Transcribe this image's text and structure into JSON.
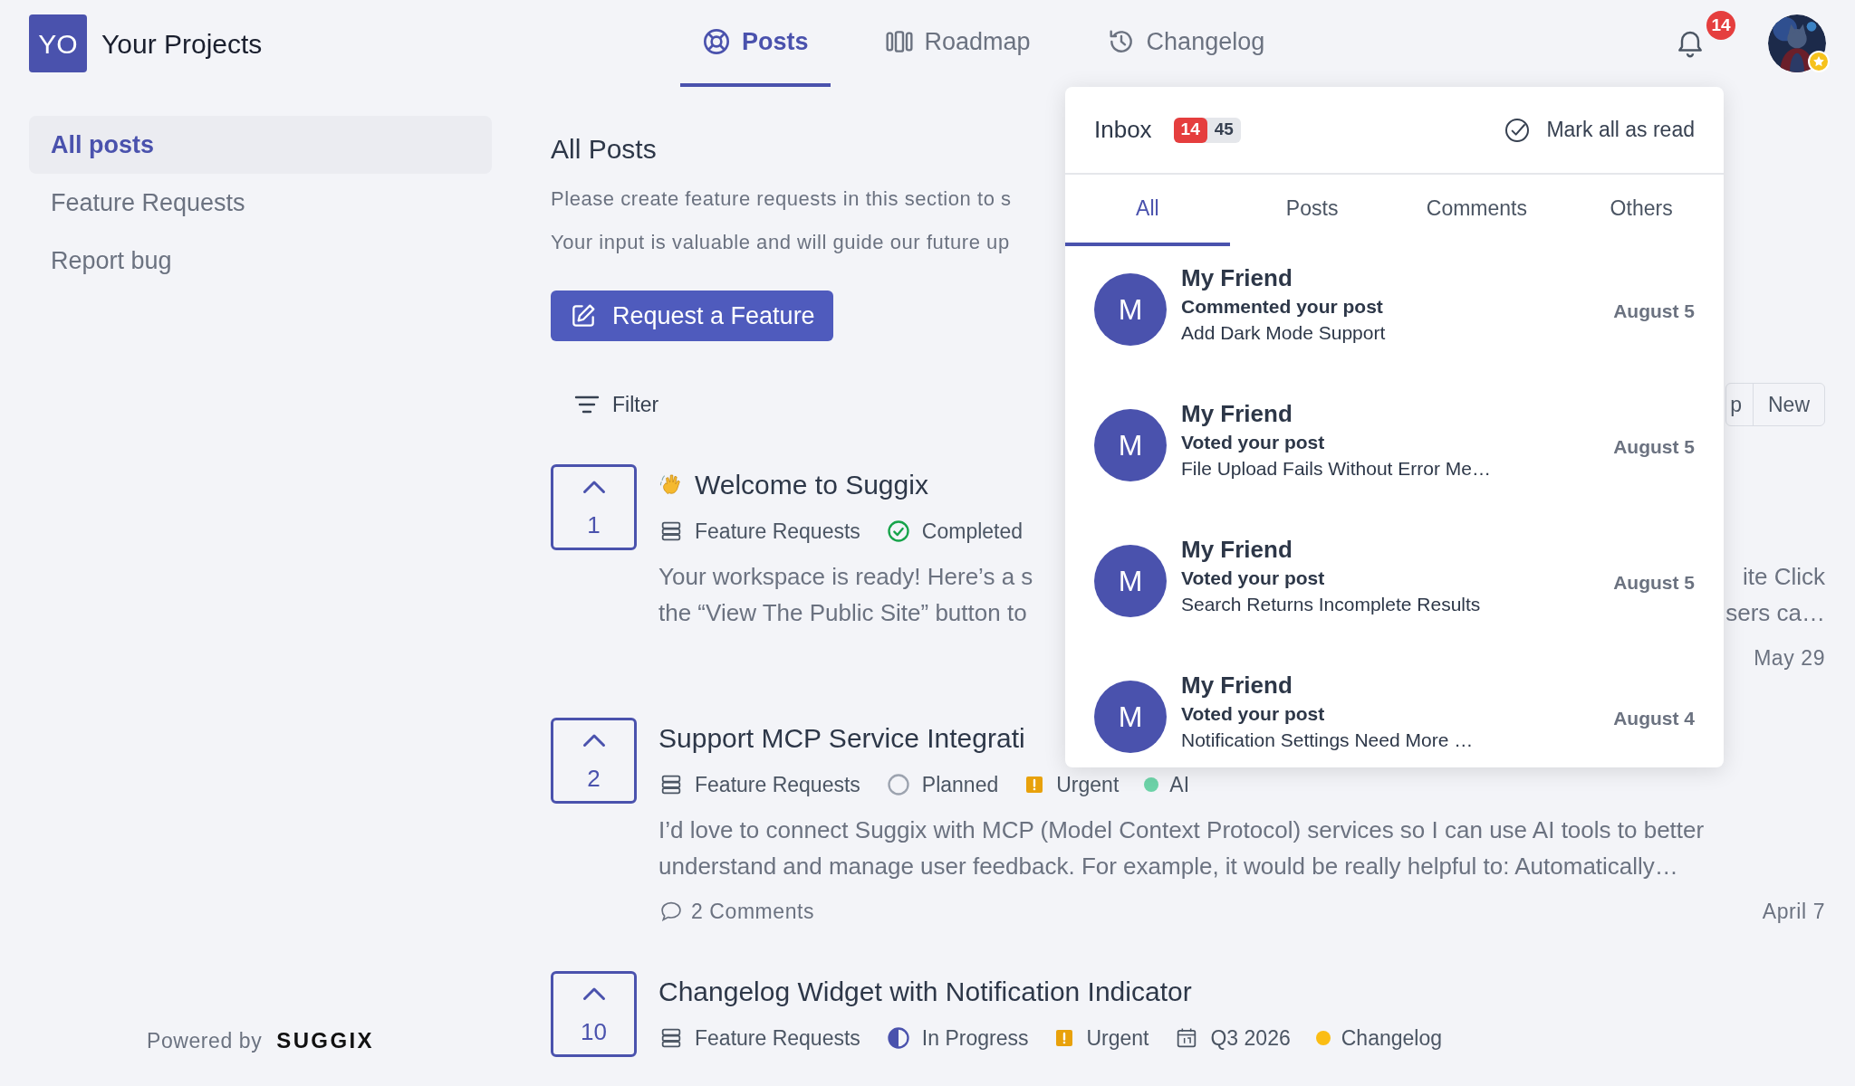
{
  "header": {
    "logo_initials": "YO",
    "project": "Your Projects",
    "nav": [
      {
        "label": "Posts",
        "kind": "lifebuoy",
        "selected": true
      },
      {
        "label": "Roadmap",
        "kind": "columns",
        "selected": false
      },
      {
        "label": "Changelog",
        "kind": "history",
        "selected": false
      }
    ],
    "notifications": "14"
  },
  "sidebar": {
    "items": [
      {
        "label": "All posts",
        "selected": true
      },
      {
        "label": "Feature Requests",
        "selected": false
      },
      {
        "label": "Report bug",
        "selected": false
      }
    ],
    "powered_by": "Powered by",
    "brand": "SUGGIX"
  },
  "main": {
    "title": "All Posts",
    "description": [
      "Please create feature requests in this section to s",
      "Your input is valuable and will guide our future up"
    ],
    "request_button": "Request a Feature",
    "filter": "Filter",
    "sort": [
      "p",
      "New"
    ],
    "posts": [
      {
        "votes": "1",
        "wave": true,
        "title": "Welcome to Suggix",
        "meta": [
          {
            "kind": "category",
            "text": "Feature Requests"
          },
          {
            "kind": "completed",
            "text": "Completed"
          }
        ],
        "body": [
          {
            "text": "Your workspace is ready! Here’s a s",
            "right": "ite Click"
          },
          {
            "text": "the “View The Public Site” button to",
            "right": "sers ca…"
          }
        ],
        "date": "May 29"
      },
      {
        "votes": "2",
        "wave": false,
        "title": "Support MCP Service Integrati",
        "meta": [
          {
            "kind": "category",
            "text": "Feature Requests"
          },
          {
            "kind": "planned",
            "text": "Planned"
          },
          {
            "kind": "priority",
            "text": "Urgent"
          },
          {
            "kind": "tag",
            "color": "#6dd3a8",
            "text": "AI"
          }
        ],
        "body": [
          {
            "text": "I’d love to connect Suggix with MCP (Model Context Protocol) services so I can use AI tools to better"
          },
          {
            "text": "understand and manage user feedback. For example, it would be really helpful to: Automatically…"
          }
        ],
        "comments": "2 Comments",
        "date": "April 7"
      },
      {
        "votes": "10",
        "wave": false,
        "title": "Changelog Widget with Notification Indicator",
        "meta": [
          {
            "kind": "category",
            "text": "Feature Requests"
          },
          {
            "kind": "progress",
            "text": "In Progress"
          },
          {
            "kind": "priority",
            "text": "Urgent"
          },
          {
            "kind": "date",
            "text": "Q3 2026"
          },
          {
            "kind": "tag",
            "color": "#fbbd14",
            "text": "Changelog"
          }
        ]
      }
    ]
  },
  "inbox": {
    "title": "Inbox",
    "unread": "14",
    "total": "45",
    "mark_read": "Mark all as read",
    "tabs": [
      {
        "label": "All",
        "selected": true
      },
      {
        "label": "Posts",
        "selected": false
      },
      {
        "label": "Comments",
        "selected": false
      },
      {
        "label": "Others",
        "selected": false
      }
    ],
    "items": [
      {
        "initial": "M",
        "name": "My Friend",
        "action": "Commented your post",
        "post": "Add Dark Mode Support",
        "date": "August 5"
      },
      {
        "initial": "M",
        "name": "My Friend",
        "action": "Voted your post",
        "post": "File Upload Fails Without Error Me…",
        "date": "August 5"
      },
      {
        "initial": "M",
        "name": "My Friend",
        "action": "Voted your post",
        "post": "Search Returns Incomplete Results",
        "date": "August 5"
      },
      {
        "initial": "M",
        "name": "My Friend",
        "action": "Voted your post",
        "post": "Notification Settings Need More …",
        "date": "August 4"
      }
    ]
  }
}
